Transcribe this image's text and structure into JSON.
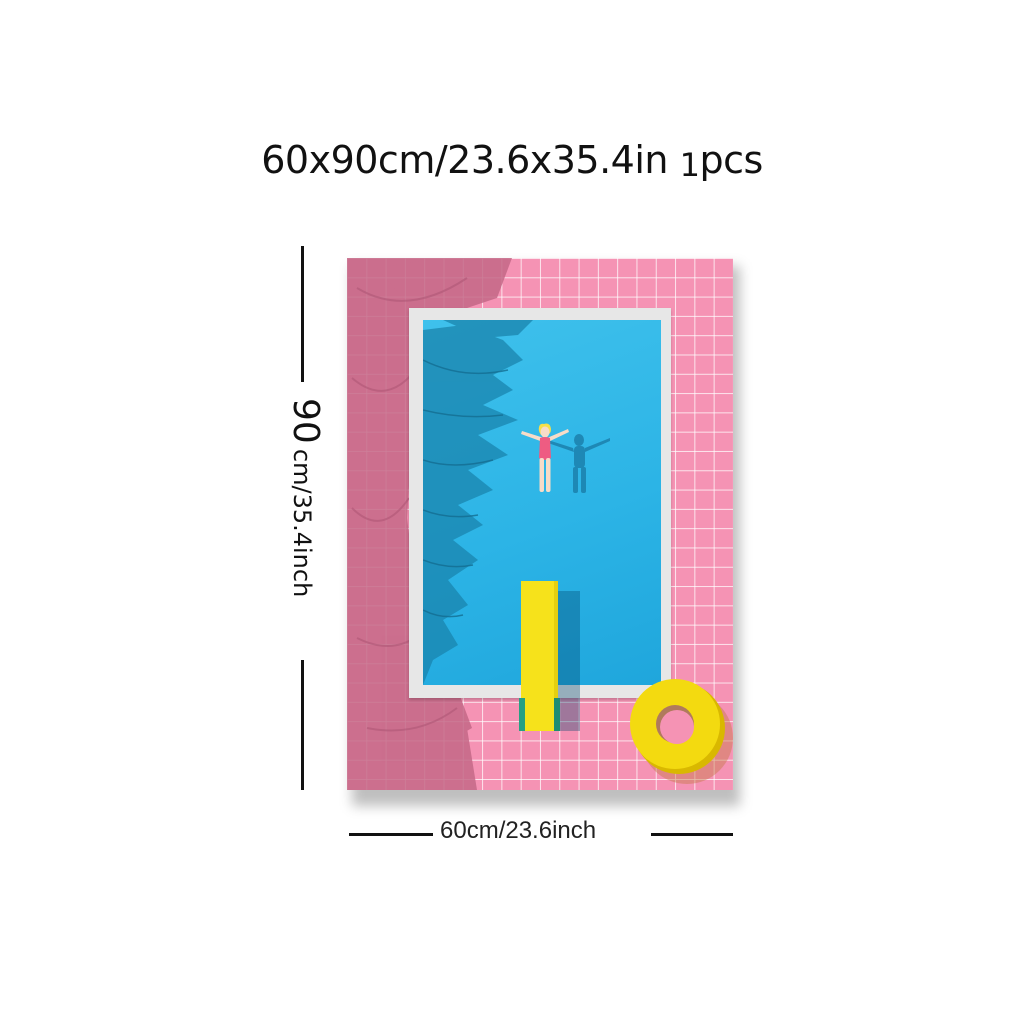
{
  "header": {
    "size_text": "60x90cm/23.6x35.4in",
    "qty_number": "1",
    "qty_unit": "pcs"
  },
  "dimensions": {
    "height_number": "90",
    "height_unit": "cm/35.4inch",
    "width_label": "60cm/23.6inch"
  },
  "artwork": {
    "colors": {
      "tile": "#f593b4",
      "tile_shadow": "#c96b8b",
      "water": "#2cb4e6",
      "water_shadow": "#1a7fa8",
      "board": "#f6e21b",
      "ring": "#f3da10",
      "rim": "#e7e7e7"
    },
    "elements": [
      "palm-shadow",
      "pool",
      "swimmer",
      "diving-board",
      "swim-ring"
    ]
  }
}
